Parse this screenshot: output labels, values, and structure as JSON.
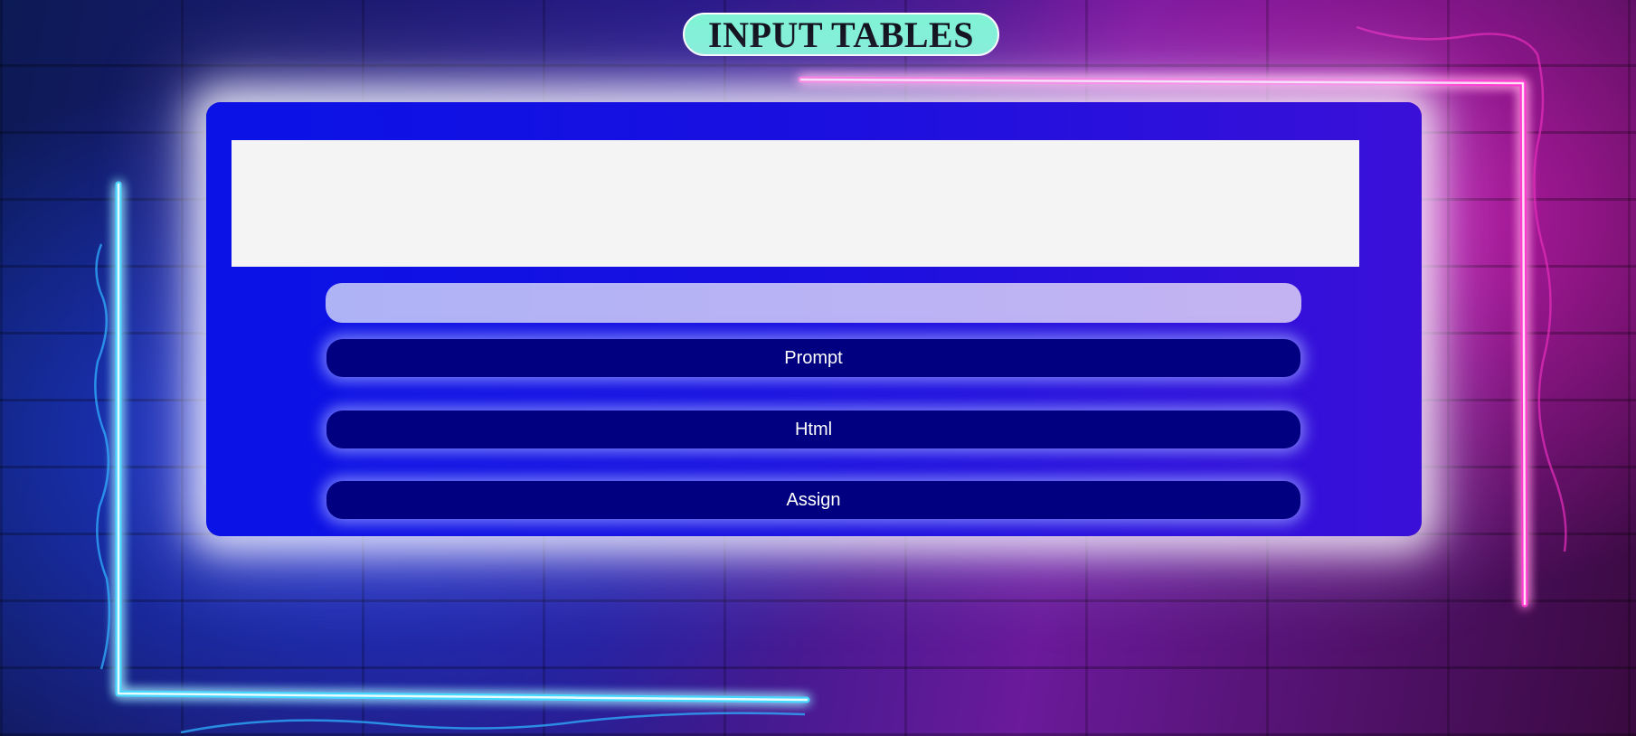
{
  "page": {
    "title": "INPUT TABLES"
  },
  "output_area": {
    "value": ""
  },
  "input": {
    "value": "",
    "placeholder": ""
  },
  "buttons": {
    "prompt_label": "Prompt",
    "html_label": "Html",
    "assign_label": "Assign"
  },
  "colors": {
    "title_pill": "#7ff5d5",
    "panel": "#0a12e6",
    "button": "#000080",
    "input": "#b8b4f4",
    "output_area": "#f4f4f4",
    "neon_blue": "#46d8ff",
    "neon_pink": "#ff3ad0"
  }
}
